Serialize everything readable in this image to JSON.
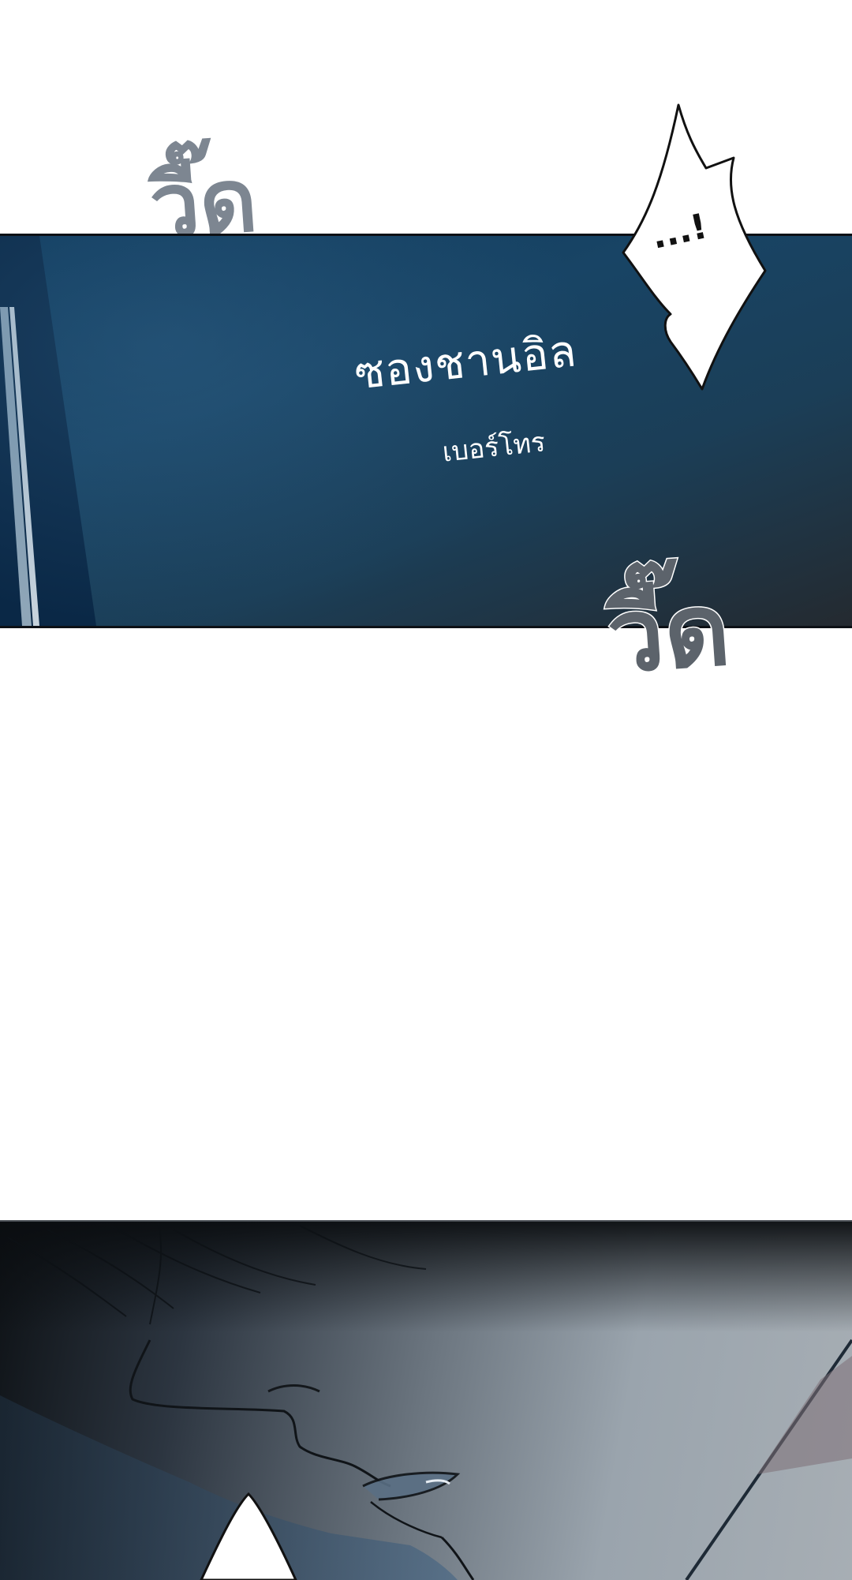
{
  "phone_screen": {
    "caller_name": "ซองชานอิล",
    "caller_subtitle": "เบอร์โทร"
  },
  "sound_effects": {
    "vibrate_top": "วี๊ด",
    "vibrate_bottom": "วี๊ด"
  },
  "speech_bubble": {
    "text": "...!"
  },
  "colors": {
    "phone_screen_dark": "#0f3a5c",
    "phone_screen_mid": "#1b3e57",
    "sfx_gray": "#7a8490",
    "face_shadow": "#2c3540",
    "face_light": "#9aa4ad"
  }
}
